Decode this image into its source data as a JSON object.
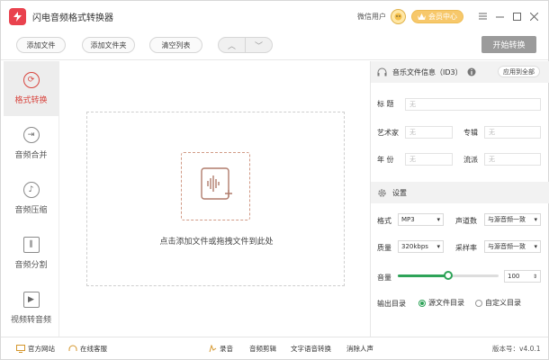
{
  "app": {
    "title": "闪电音频格式转换器",
    "user": "微信用户",
    "vip_label": "会员中心"
  },
  "toolbar": {
    "add_file": "添加文件",
    "add_folder": "添加文件夹",
    "clear_list": "清空列表",
    "start": "开始转换"
  },
  "sidebar": {
    "items": [
      {
        "label": "格式转换",
        "icon": "refresh-icon"
      },
      {
        "label": "音频合并",
        "icon": "merge-icon"
      },
      {
        "label": "音频压缩",
        "icon": "compress-icon"
      },
      {
        "label": "音频分割",
        "icon": "split-icon"
      },
      {
        "label": "视频转音频",
        "icon": "video-icon"
      }
    ]
  },
  "main": {
    "drop_text": "点击添加文件或拖拽文件到此处"
  },
  "info": {
    "title": "音乐文件信息（ID3）",
    "apply_all": "应用到全部",
    "labels": {
      "song_title": "标  题",
      "artist": "艺术家",
      "album": "专辑",
      "year": "年  份",
      "genre": "流派"
    },
    "placeholder": "无"
  },
  "settings": {
    "title": "设置",
    "format_label": "格式",
    "format_value": "MP3",
    "channels_label": "声道数",
    "channels_value": "与源音频一致",
    "quality_label": "质量",
    "quality_value": "320kbps",
    "samplerate_label": "采样率",
    "samplerate_value": "与源音频一致",
    "volume_label": "音量",
    "volume_value": "100",
    "volume_fraction": 0.5,
    "output_label": "输出目录",
    "output_source": "源文件目录",
    "output_custom": "自定义目录"
  },
  "status": {
    "website": "官方网站",
    "support": "在线客服",
    "links": [
      "录音",
      "音频剪辑",
      "文字语音转换",
      "消除人声"
    ],
    "version": "版本号：v4.0.1"
  },
  "colors": {
    "accent": "#d8453e",
    "vip": "#f7c86b"
  }
}
